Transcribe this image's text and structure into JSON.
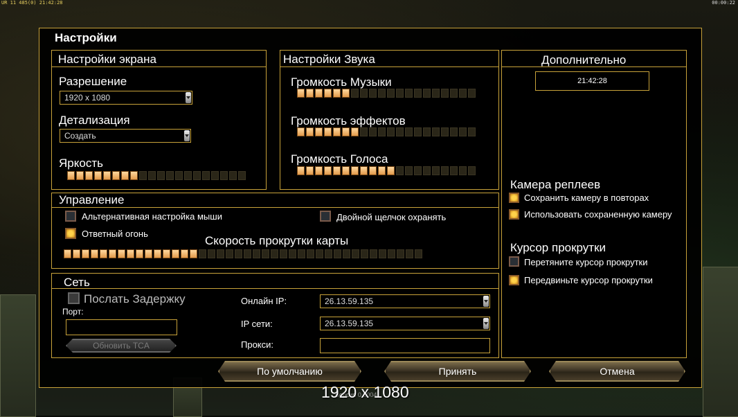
{
  "hud": {
    "top_left": "UR 11 485(0) 21:42:28",
    "top_right": "00:00:22"
  },
  "dialog": {
    "title": "Настройки"
  },
  "screen": {
    "title": "Настройки экрана",
    "resolution_label": "Разрешение",
    "resolution_value": "1920 x 1080",
    "detail_label": "Детализация",
    "detail_value": "Создать",
    "brightness_label": "Яркость",
    "brightness_level": 8,
    "brightness_max": 20
  },
  "sound": {
    "title": "Настройки Звука",
    "music_label": "Громкость Музыки",
    "music_level": 6,
    "effects_label": "Громкость эффектов",
    "effects_level": 7,
    "voice_label": "Громкость Голоса",
    "voice_level": 11,
    "max": 20
  },
  "extra": {
    "title": "Дополнительно",
    "clock": "21:42:28",
    "replay_camera_title": "Камера реплеев",
    "save_camera_label": "Сохранить камеру в повторах",
    "use_saved_camera_label": "Использовать сохраненную камеру",
    "scroll_cursor_title": "Курсор прокрутки",
    "drag_cursor_label": "Перетяните курсор прокрутки",
    "move_cursor_label": "Передвиньте курсор прокрутки"
  },
  "control": {
    "title": "Управление",
    "alt_mouse_label": "Альтернативная настройка мыши",
    "double_click_label": "Двойной щелчок охранять",
    "return_fire_label": "Ответный огонь",
    "scroll_speed_label": "Скорость прокрутки карты",
    "scroll_speed_level": 15,
    "scroll_speed_max": 40
  },
  "network": {
    "title": "Сеть",
    "send_delay_label": "Послать Задержку",
    "port_label": "Порт:",
    "port_value": "",
    "update_tca_label": "Обновить TCA",
    "online_ip_label": "Онлайн IP:",
    "online_ip_value": "26.13.59.135",
    "lan_ip_label": "IP сети:",
    "lan_ip_value": "26.13.59.135",
    "proxy_label": "Прокси:",
    "proxy_value": ""
  },
  "buttons": {
    "defaults": "По умолчанию",
    "accept": "Принять",
    "cancel": "Отмена"
  },
  "footer": {
    "resolution": "1920 x 1080",
    "version": "Версия 0.0004"
  },
  "colors": {
    "border": "#c9a33a",
    "slider_on": "#f0b46a",
    "slider_off": "#2a2618"
  }
}
